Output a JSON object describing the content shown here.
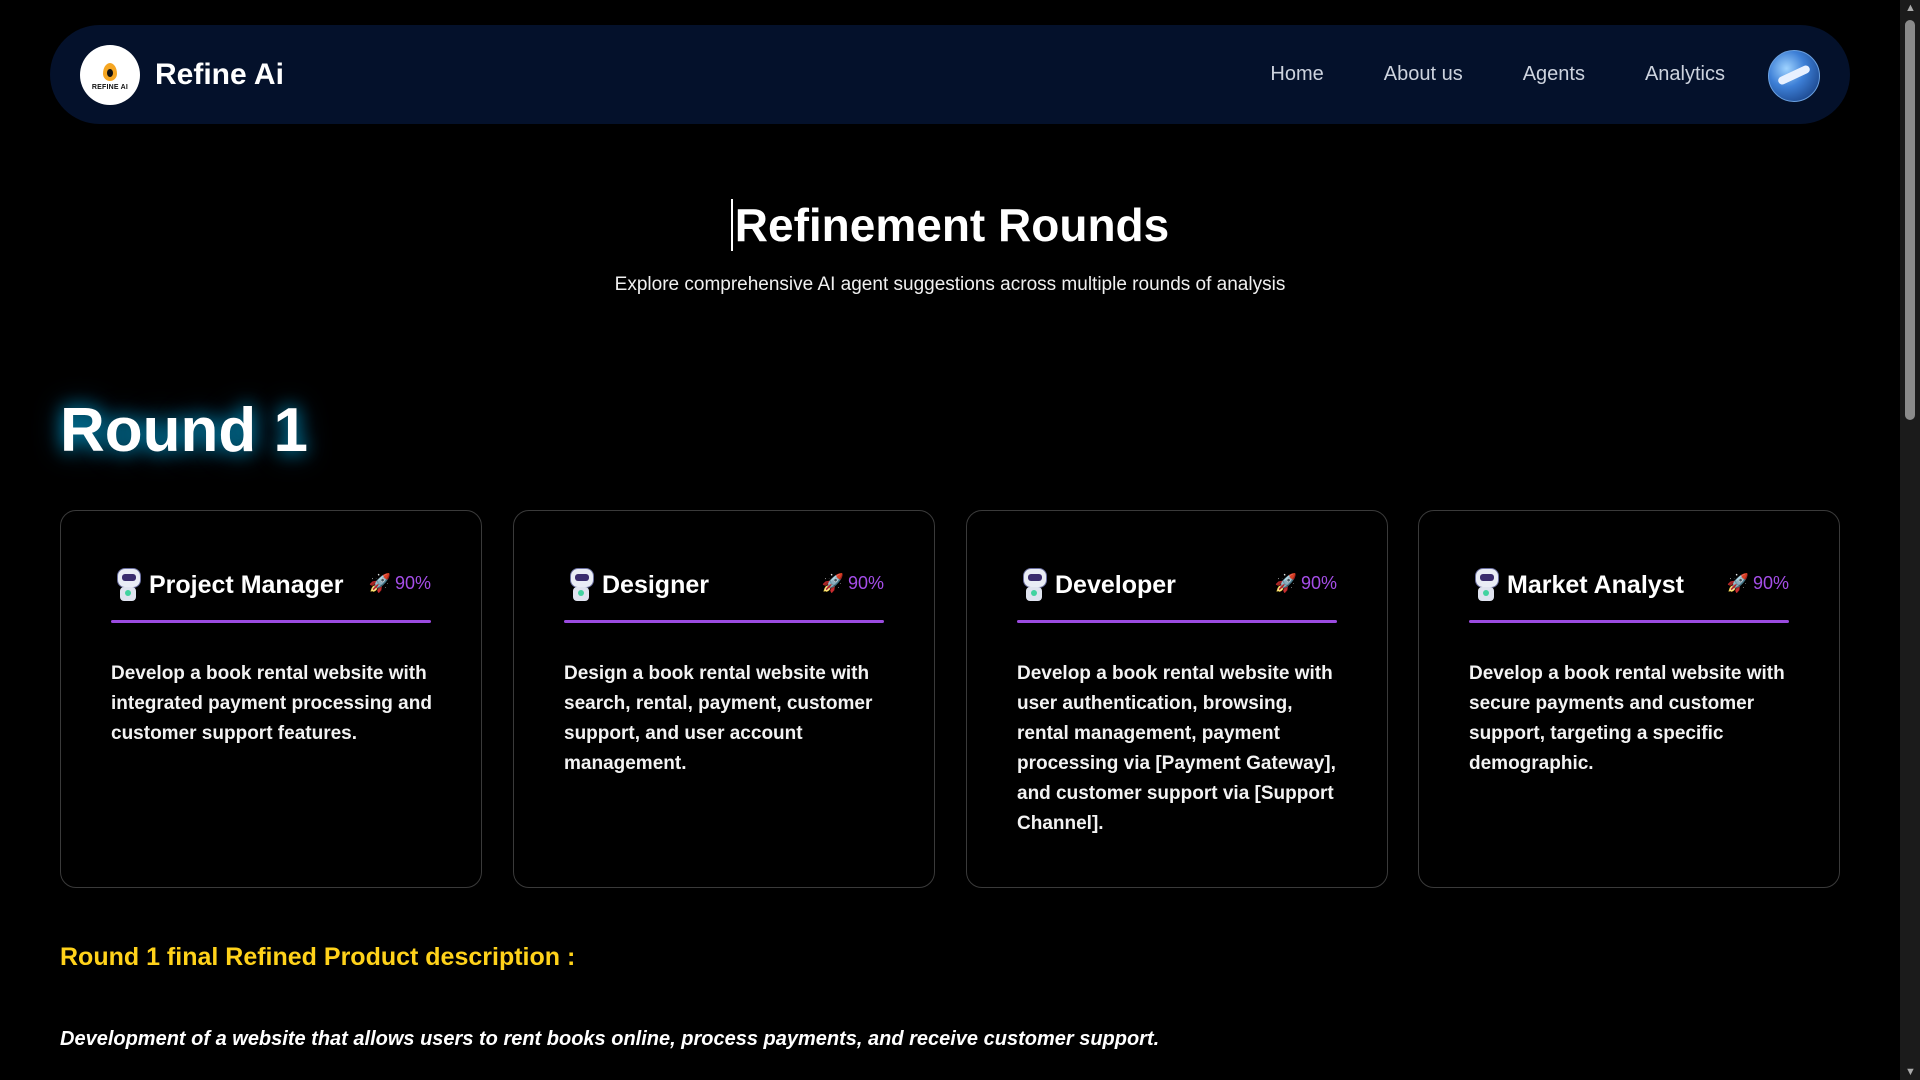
{
  "header": {
    "brand_name": "Refine Ai",
    "logo_text": "REFINE AI",
    "nav": [
      "Home",
      "About us",
      "Agents",
      "Analytics"
    ]
  },
  "hero": {
    "title": "Refinement Rounds",
    "subtitle": "Explore comprehensive AI agent suggestions across multiple rounds of analysis"
  },
  "round": {
    "title": "Round 1",
    "cards": [
      {
        "title": "Project Manager",
        "score": "90%",
        "description": "Develop a book rental website with integrated payment processing and customer support features."
      },
      {
        "title": "Designer",
        "score": "90%",
        "description": "Design a book rental website with search, rental, payment, customer support, and user account management."
      },
      {
        "title": "Developer",
        "score": "90%",
        "description": "Develop a book rental website with user authentication, browsing, rental management, payment processing via [Payment Gateway], and customer support via [Support Channel]."
      },
      {
        "title": "Market Analyst",
        "score": "90%",
        "description": "Develop a book rental website with secure payments and customer support, targeting a specific demographic."
      }
    ],
    "final_title": "Round 1 final Refined Product description :",
    "final_description": "Development of a website that allows users to rent books online, process payments, and receive customer support."
  },
  "icons": {
    "agent": "robot-icon",
    "score": "rocket-icon",
    "avatar": "user-avatar"
  },
  "colors": {
    "navbar_bg": "#04112b",
    "accent_purple": "#9b4be0",
    "final_title": "#ffd21a",
    "glow": "#00c8ff"
  }
}
